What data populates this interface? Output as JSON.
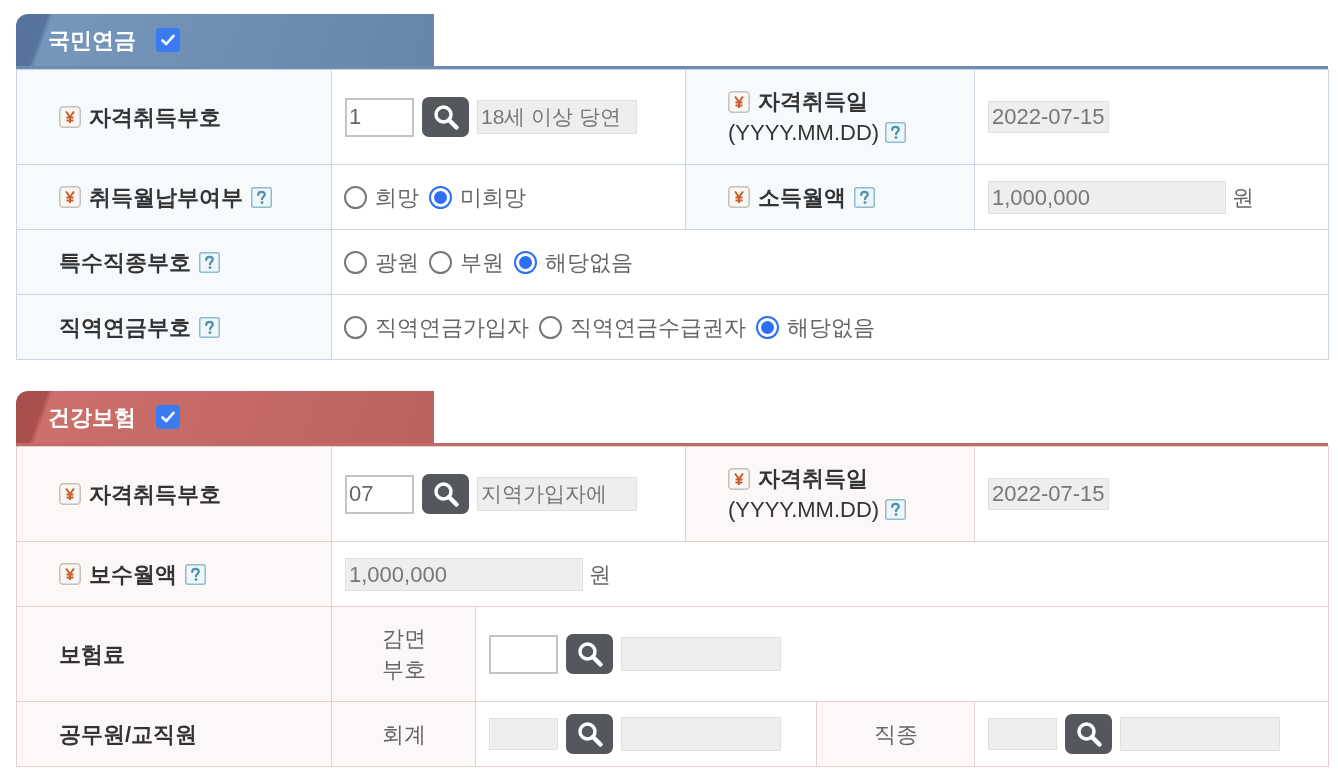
{
  "sections": [
    {
      "kind": "pension",
      "title": "국민연금",
      "checked": true,
      "rows": [
        {
          "cells": [
            {
              "kind": "label",
              "text": "자격취득부호",
              "required": true,
              "help": false
            },
            {
              "kind": "lookup",
              "colspan": 2,
              "code": "1",
              "name": "18세 이상 당연",
              "disabled": false
            },
            {
              "kind": "label",
              "colspan": 2,
              "text": "자격취득일",
              "note": "(YYYY.MM.DD)",
              "required": true,
              "help": true
            },
            {
              "kind": "field",
              "value": "2022-07-15"
            }
          ]
        },
        {
          "cells": [
            {
              "kind": "label",
              "text": "취득월납부여부",
              "required": true,
              "help": true
            },
            {
              "kind": "radios",
              "colspan": 2,
              "options": [
                {
                  "label": "희망",
                  "selected": false
                },
                {
                  "label": "미희망",
                  "selected": true
                }
              ]
            },
            {
              "kind": "label",
              "colspan": 2,
              "text": "소득월액",
              "required": true,
              "help": true
            },
            {
              "kind": "amount",
              "value": "1,000,000",
              "unit": "원"
            }
          ]
        },
        {
          "cells": [
            {
              "kind": "label",
              "text": "특수직종부호",
              "required": false,
              "help": true
            },
            {
              "kind": "radios",
              "colspan": 5,
              "options": [
                {
                  "label": "광원",
                  "selected": false
                },
                {
                  "label": "부원",
                  "selected": false
                },
                {
                  "label": "해당없음",
                  "selected": true
                }
              ]
            }
          ]
        },
        {
          "cells": [
            {
              "kind": "label",
              "text": "직역연금부호",
              "required": false,
              "help": true
            },
            {
              "kind": "radios",
              "colspan": 5,
              "options": [
                {
                  "label": "직역연금가입자",
                  "selected": false
                },
                {
                  "label": "직역연금수급권자",
                  "selected": false
                },
                {
                  "label": "해당없음",
                  "selected": true
                }
              ]
            }
          ]
        }
      ]
    },
    {
      "kind": "health",
      "title": "건강보험",
      "checked": true,
      "rows": [
        {
          "cells": [
            {
              "kind": "label",
              "text": "자격취득부호",
              "required": true,
              "help": false
            },
            {
              "kind": "lookup",
              "colspan": 2,
              "code": "07",
              "name": "지역가입자에",
              "disabled": false
            },
            {
              "kind": "label",
              "colspan": 2,
              "text": "자격취득일",
              "note": "(YYYY.MM.DD)",
              "required": true,
              "help": true
            },
            {
              "kind": "field",
              "value": "2022-07-15"
            }
          ]
        },
        {
          "cells": [
            {
              "kind": "label",
              "text": "보수월액",
              "required": true,
              "help": true
            },
            {
              "kind": "amount",
              "colspan": 5,
              "value": "1,000,000",
              "unit": "원"
            }
          ]
        },
        {
          "cells": [
            {
              "kind": "label",
              "text": "보험료",
              "required": false,
              "help": false
            },
            {
              "kind": "sublabel",
              "text": "감면부호"
            },
            {
              "kind": "lookup",
              "colspan": 4,
              "disabled": false
            }
          ]
        },
        {
          "cells": [
            {
              "kind": "label",
              "text": "공무원/교직원",
              "required": false,
              "help": false
            },
            {
              "kind": "sublabel",
              "text": "회계"
            },
            {
              "kind": "lookup",
              "colspan": 2,
              "disabled": true
            },
            {
              "kind": "sublabel",
              "text": "직종"
            },
            {
              "kind": "lookup",
              "disabled": true
            }
          ]
        }
      ]
    }
  ]
}
